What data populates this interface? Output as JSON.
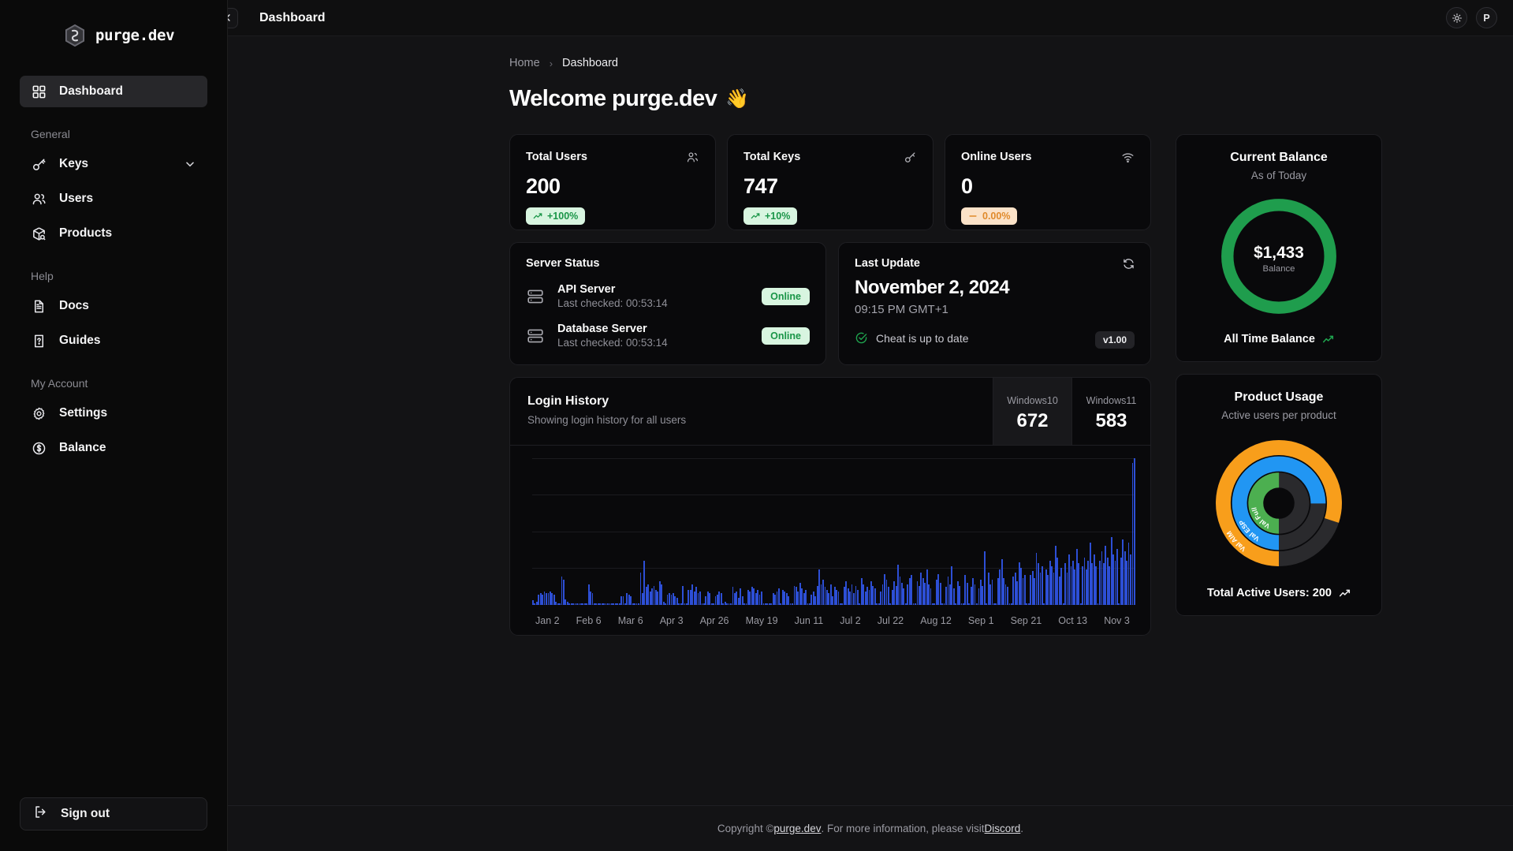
{
  "brand": {
    "name": "purge.dev",
    "logo_icon": "hexagon-logo-icon"
  },
  "sidebar": {
    "items": [
      {
        "label": "Dashboard",
        "icon": "grid-icon",
        "active": true
      }
    ],
    "groups": [
      {
        "label": "General",
        "items": [
          {
            "label": "Keys",
            "icon": "key-icon",
            "chevron": "chevron-down-icon"
          },
          {
            "label": "Users",
            "icon": "users-icon"
          },
          {
            "label": "Products",
            "icon": "package-search-icon"
          }
        ]
      },
      {
        "label": "Help",
        "items": [
          {
            "label": "Docs",
            "icon": "file-text-icon"
          },
          {
            "label": "Guides",
            "icon": "file-question-icon"
          }
        ]
      },
      {
        "label": "My Account",
        "items": [
          {
            "label": "Settings",
            "icon": "gear-icon"
          },
          {
            "label": "Balance",
            "icon": "dollar-circle-icon"
          }
        ]
      }
    ],
    "sign_out": {
      "label": "Sign out",
      "icon": "logout-icon"
    }
  },
  "topbar": {
    "collapse_icon": "chevron-left-icon",
    "title": "Dashboard",
    "theme_toggle_icon": "sun-icon",
    "avatar_initial": "P"
  },
  "breadcrumb": {
    "home": "Home",
    "separator": "›",
    "current": "Dashboard"
  },
  "welcome": {
    "text": "Welcome purge.dev",
    "emoji": "👋"
  },
  "stats": [
    {
      "label": "Total Users",
      "value": "200",
      "icon": "users-icon",
      "badge": "+100%",
      "badge_tone": "green",
      "badge_icon": "trend-up-icon"
    },
    {
      "label": "Total Keys",
      "value": "747",
      "icon": "key-icon",
      "badge": "+10%",
      "badge_tone": "green",
      "badge_icon": "trend-up-icon"
    },
    {
      "label": "Online Users",
      "value": "0",
      "icon": "wifi-icon",
      "badge": "0.00%",
      "badge_tone": "orange",
      "badge_icon": "minus-icon"
    }
  ],
  "server_status": {
    "title": "Server Status",
    "servers": [
      {
        "name": "API Server",
        "last_checked": "Last checked: 00:53:14",
        "status": "Online",
        "icon": "server-icon"
      },
      {
        "name": "Database Server",
        "last_checked": "Last checked: 00:53:14",
        "status": "Online",
        "icon": "server-icon"
      }
    ]
  },
  "last_update": {
    "title": "Last Update",
    "date": "November 2, 2024",
    "time": "09:15 PM GMT+1",
    "status_text": "Cheat is up to date",
    "status_icon": "check-circle-icon",
    "version": "v1.00",
    "refresh_icon": "refresh-icon"
  },
  "login_history": {
    "title": "Login History",
    "subtitle": "Showing login history for all users",
    "os_stats": [
      {
        "label": "Windows10",
        "value": "672",
        "selected": true
      },
      {
        "label": "Windows11",
        "value": "583",
        "selected": false
      }
    ]
  },
  "current_balance": {
    "title": "Current Balance",
    "subtitle": "As of Today",
    "amount": "$1,433",
    "amount_label": "Balance",
    "ring_color": "#1f9d4d",
    "footer": "All Time Balance",
    "footer_icon": "trend-up-icon"
  },
  "product_usage": {
    "title": "Product Usage",
    "subtitle": "Active users per product",
    "footer": "Total Active Users: 200",
    "footer_icon": "trend-up-icon",
    "track_color": "#2a2a2d"
  },
  "footer": {
    "prefix": "Copyright © ",
    "brand_link": "purge.dev",
    "middle": ". For more information, please visit ",
    "discord_link": "Discord",
    "suffix": "."
  },
  "chart_data": [
    {
      "type": "bar",
      "title": "Login History",
      "subtitle": "Showing login history for all users",
      "xlabel": "",
      "ylabel": "",
      "grid": true,
      "bar_color": "#2d4fd6",
      "tick_labels": [
        "Jan 2",
        "Feb 6",
        "Mar 6",
        "Apr 3",
        "Apr 26",
        "May 19",
        "Jun 11",
        "Jul 2",
        "Jul 22",
        "Aug 12",
        "Sep 1",
        "Sep 21",
        "Oct 13",
        "Nov 3"
      ],
      "ylim": [
        0,
        100
      ],
      "values": [
        3,
        1,
        2,
        7,
        8,
        7,
        9,
        8,
        8,
        9,
        8,
        7,
        2,
        1,
        1,
        19,
        17,
        4,
        2,
        1,
        1,
        1,
        1,
        1,
        1,
        1,
        1,
        1,
        1,
        14,
        9,
        8,
        1,
        1,
        1,
        1,
        1,
        1,
        1,
        1,
        1,
        1,
        1,
        1,
        1,
        1,
        6,
        6,
        1,
        8,
        7,
        6,
        1,
        1,
        1,
        1,
        22,
        8,
        30,
        12,
        14,
        9,
        11,
        13,
        10,
        9,
        16,
        14,
        2,
        1,
        7,
        8,
        7,
        8,
        6,
        5,
        1,
        1,
        13,
        1,
        1,
        10,
        10,
        14,
        9,
        12,
        8,
        9,
        1,
        1,
        6,
        9,
        8,
        1,
        1,
        6,
        7,
        9,
        8,
        1,
        2,
        1,
        1,
        1,
        12,
        8,
        9,
        5,
        11,
        6,
        1,
        1,
        10,
        9,
        12,
        11,
        8,
        10,
        7,
        9,
        1,
        1,
        1,
        1,
        1,
        8,
        7,
        9,
        11,
        1,
        10,
        9,
        8,
        6,
        1,
        1,
        13,
        12,
        9,
        15,
        11,
        8,
        10,
        1,
        1,
        7,
        9,
        6,
        13,
        24,
        14,
        17,
        12,
        10,
        8,
        14,
        6,
        12,
        10,
        9,
        1,
        1,
        12,
        16,
        11,
        9,
        14,
        8,
        13,
        10,
        1,
        18,
        14,
        9,
        12,
        10,
        16,
        13,
        11,
        1,
        1,
        9,
        14,
        21,
        17,
        12,
        1,
        10,
        16,
        13,
        27,
        19,
        15,
        11,
        1,
        14,
        18,
        20,
        1,
        1,
        16,
        13,
        22,
        18,
        15,
        24,
        14,
        11,
        1,
        1,
        17,
        21,
        15,
        1,
        1,
        12,
        19,
        14,
        26,
        11,
        1,
        16,
        13,
        1,
        1,
        20,
        15,
        1,
        12,
        18,
        14,
        1,
        11,
        17,
        13,
        36,
        1,
        22,
        14,
        17,
        1,
        1,
        18,
        24,
        31,
        18,
        14,
        12,
        1,
        1,
        19,
        22,
        16,
        29,
        25,
        18,
        20,
        1,
        1,
        20,
        23,
        18,
        35,
        28,
        22,
        26,
        1,
        24,
        20,
        30,
        26,
        22,
        40,
        32,
        19,
        25,
        1,
        28,
        22,
        34,
        26,
        30,
        24,
        38,
        28,
        1,
        26,
        32,
        24,
        30,
        42,
        28,
        34,
        26,
        1,
        30,
        36,
        28,
        40,
        32,
        26,
        46,
        34,
        30,
        38,
        1,
        32,
        44,
        36,
        30,
        42,
        34,
        96,
        99
      ]
    },
    {
      "type": "pie",
      "subtype": "radial-bar",
      "title": "Product Usage",
      "subtitle": "Active users per product",
      "legend_position": "inline-labels",
      "series": [
        {
          "name": "Val AIM",
          "value": 80,
          "color": "#f89e1b",
          "ring": "outer"
        },
        {
          "name": "Val ESP",
          "value": 75,
          "color": "#2196f3",
          "ring": "middle"
        },
        {
          "name": "Val Full",
          "value": 50,
          "color": "#4caf50",
          "ring": "inner"
        }
      ],
      "track_color": "#2a2a2d",
      "total_label": "Total Active Users: 200"
    },
    {
      "type": "pie",
      "subtype": "donut-ring",
      "title": "Current Balance",
      "subtitle": "As of Today",
      "series": [
        {
          "name": "Balance",
          "value": 1433,
          "display": "$1,433",
          "color": "#1f9d4d"
        }
      ]
    }
  ]
}
